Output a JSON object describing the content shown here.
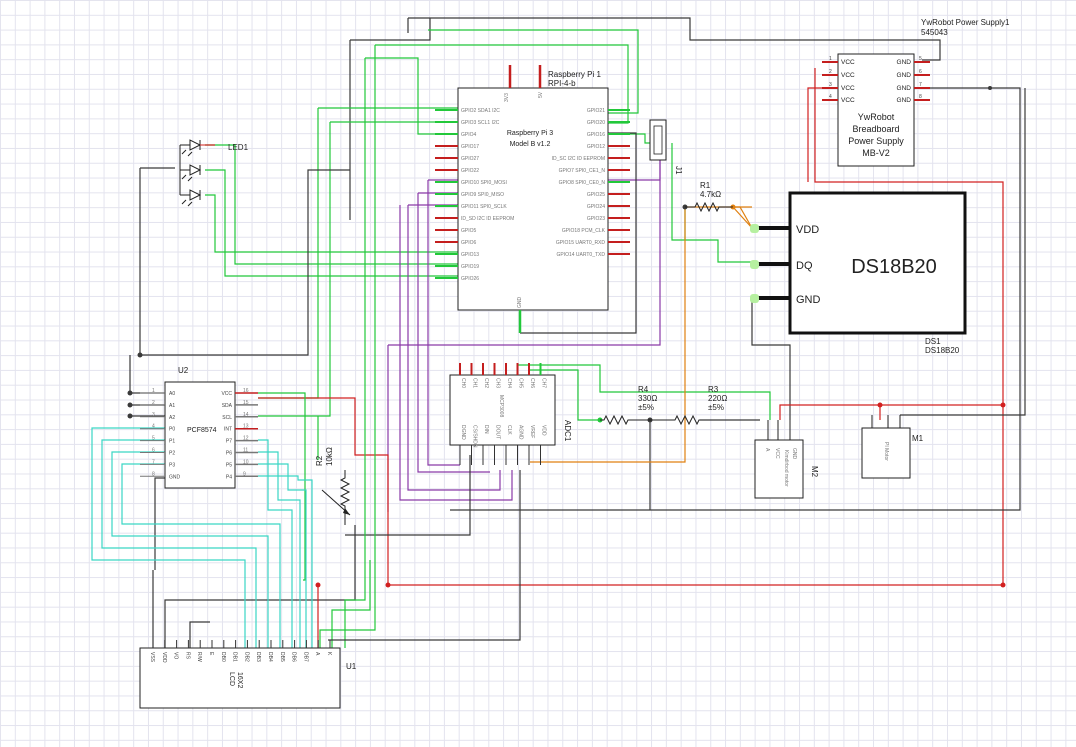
{
  "colors": {
    "wire_green": "#22c83a",
    "wire_black": "#3a3a3a",
    "wire_red": "#d22020",
    "wire_purple": "#8a3aa8",
    "wire_cyan": "#3ad6c4",
    "wire_orange": "#e08010",
    "part_stroke": "#222222",
    "pin_red": "#c41e1e",
    "pin_green_hilite": "#b6f0a0"
  },
  "parts": {
    "psu": {
      "title": "YwRobot Power Supply1",
      "code": "545043",
      "body": [
        "YwRobot",
        "Breadboard",
        "Power Supply",
        "MB-V2"
      ],
      "left_pins": [
        "VCC",
        "VCC",
        "VCC",
        "VCC"
      ],
      "left_nums": [
        "1",
        "2",
        "3",
        "4"
      ],
      "right_pins": [
        "GND",
        "GND",
        "GND",
        "GND"
      ],
      "right_nums": [
        "5",
        "6",
        "7",
        "8"
      ]
    },
    "rpi": {
      "label1": "Raspberry Pi 1",
      "label2": "RPI-4-b",
      "body1": "Raspberry Pi 3",
      "body2": "Model B v1.2",
      "top_pins": [
        "3V3",
        "5V"
      ],
      "left_pins": [
        "GPIO2 SDA1 I2C",
        "GPIO3 SCL1 I2C",
        "GPIO4",
        "GPIO17",
        "GPIO27",
        "GPIO22",
        "GPIO10 SPI0_MOSI",
        "GPIO9 SPI0_MISO",
        "GPIO11 SPI0_SCLK",
        "ID_SD I2C ID EEPROM",
        "GPIO5",
        "GPIO6",
        "GPIO13",
        "GPIO19",
        "GPIO26"
      ],
      "right_pins": [
        "GPIO21",
        "GPIO20",
        "GPIO16",
        "GPIO12",
        "ID_SC I2C ID EEPROM",
        "GPIO7 SPI0_CE1_N",
        "GPIO8 SPI0_CE0_N",
        "GPIO25",
        "GPIO24",
        "GPIO23",
        "GPIO18 PCM_CLK",
        "GPIO15 UART0_RXD",
        "GPIO14 UART0_TXD"
      ],
      "bottom_pin": "GND"
    },
    "led": {
      "label": "LED1"
    },
    "j1": {
      "label": "J1"
    },
    "r1": {
      "name": "R1",
      "value": "4.7kΩ"
    },
    "ds18b20": {
      "text": "DS18B20",
      "pins": [
        "VDD",
        "DQ",
        "GND"
      ],
      "ref": "DS1",
      "ref2": "DS18B20"
    },
    "u2": {
      "ref": "U2",
      "body": "PCF8574",
      "left_pins": [
        "A0",
        "A1",
        "A2",
        "P0",
        "P1",
        "P2",
        "P3",
        "GND"
      ],
      "left_nums": [
        "1",
        "2",
        "3",
        "4",
        "5",
        "6",
        "7",
        "8"
      ],
      "right_pins": [
        "VCC",
        "SDA",
        "SCL",
        "INT",
        "P7",
        "P6",
        "P5",
        "P4"
      ],
      "right_nums": [
        "16",
        "15",
        "14",
        "13",
        "12",
        "11",
        "10",
        "9"
      ]
    },
    "adc": {
      "ref": "ADC1",
      "body": "MCP3008",
      "top_pins": [
        "CH0",
        "CH1",
        "CH2",
        "CH3",
        "CH4",
        "CH5",
        "CH6",
        "CH7"
      ],
      "bottom_pins": [
        "DGND",
        "CS/SHDN",
        "DIN",
        "DOUT",
        "CLK",
        "AGND",
        "VREF",
        "VDD"
      ]
    },
    "r4": {
      "name": "R4",
      "value": "330Ω",
      "tol": "±5%"
    },
    "r3": {
      "name": "R3",
      "value": "220Ω",
      "tol": "±5%"
    },
    "r2": {
      "name": "R2",
      "value": "10kΩ"
    },
    "m2": {
      "ref": "M2",
      "body": "Kimdirbod motor",
      "pins": [
        "A",
        "VCC",
        "GND"
      ]
    },
    "m1": {
      "ref": "M1",
      "body": "PI Motor"
    },
    "lcd": {
      "ref": "U1",
      "body": "LCD",
      "size": "16X2",
      "pins": [
        "VSS",
        "VDD",
        "VO",
        "RS",
        "R/W",
        "E",
        "DB0",
        "DB1",
        "DB2",
        "DB3",
        "DB4",
        "DB5",
        "DB6",
        "DB7",
        "A",
        "K"
      ]
    }
  }
}
